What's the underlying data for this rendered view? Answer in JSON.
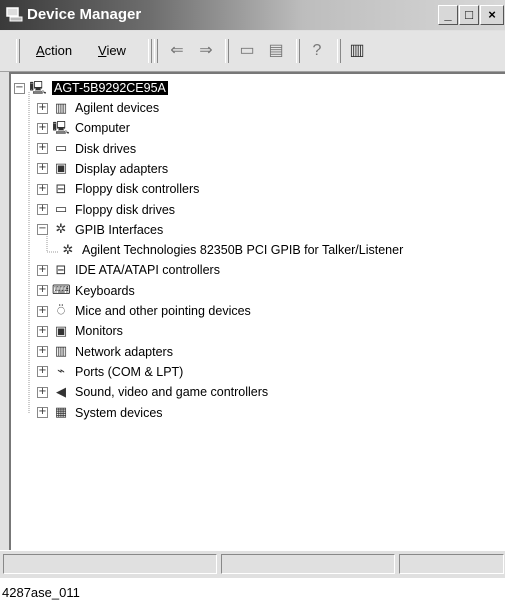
{
  "window": {
    "title": "Device Manager"
  },
  "caption_buttons": {
    "minimize": "_",
    "maximize": "□",
    "close": "×"
  },
  "menu": {
    "action": {
      "prefix": "",
      "mnemonic": "A",
      "rest": "ction"
    },
    "view": {
      "prefix": "",
      "mnemonic": "V",
      "rest": "iew"
    }
  },
  "toolbar_icons": [
    "back-arrow-icon",
    "forward-arrow-icon",
    "folder-icon",
    "properties-icon",
    "help-icon",
    "scan-hardware-icon"
  ],
  "tree": {
    "root": "AGT-5B9292CE95A",
    "items": [
      {
        "label": "Agilent devices",
        "expander": "+",
        "icon": "agilent-device-icon",
        "glyph": "▥"
      },
      {
        "label": "Computer",
        "expander": "+",
        "icon": "computer-icon",
        "glyph": "🖳"
      },
      {
        "label": "Disk drives",
        "expander": "+",
        "icon": "disk-drive-icon",
        "glyph": "▭"
      },
      {
        "label": "Display adapters",
        "expander": "+",
        "icon": "display-adapter-icon",
        "glyph": "▣"
      },
      {
        "label": "Floppy disk controllers",
        "expander": "+",
        "icon": "floppy-controller-icon",
        "glyph": "⊟"
      },
      {
        "label": "Floppy disk drives",
        "expander": "+",
        "icon": "floppy-drive-icon",
        "glyph": "▭"
      },
      {
        "label": "GPIB Interfaces",
        "expander": "−",
        "icon": "gpib-icon",
        "glyph": "✲"
      },
      {
        "label": "Agilent Technologies 82350B PCI GPIB for Talker/Listener",
        "child": true,
        "icon": "gpib-device-icon",
        "glyph": "✲"
      },
      {
        "label": "IDE ATA/ATAPI controllers",
        "expander": "+",
        "icon": "ide-controller-icon",
        "glyph": "⊟"
      },
      {
        "label": "Keyboards",
        "expander": "+",
        "icon": "keyboard-icon",
        "glyph": "⌨"
      },
      {
        "label": "Mice and other pointing devices",
        "expander": "+",
        "icon": "mouse-icon",
        "glyph": "⍥"
      },
      {
        "label": "Monitors",
        "expander": "+",
        "icon": "monitor-icon",
        "glyph": "▣"
      },
      {
        "label": "Network adapters",
        "expander": "+",
        "icon": "network-adapter-icon",
        "glyph": "▥"
      },
      {
        "label": "Ports (COM & LPT)",
        "expander": "+",
        "icon": "port-icon",
        "glyph": "⌁"
      },
      {
        "label": "Sound, video and game controllers",
        "expander": "+",
        "icon": "sound-icon",
        "glyph": "◀"
      },
      {
        "label": "System devices",
        "expander": "+",
        "icon": "system-device-icon",
        "glyph": "▦"
      }
    ]
  },
  "figure_caption": "4287ase_011"
}
